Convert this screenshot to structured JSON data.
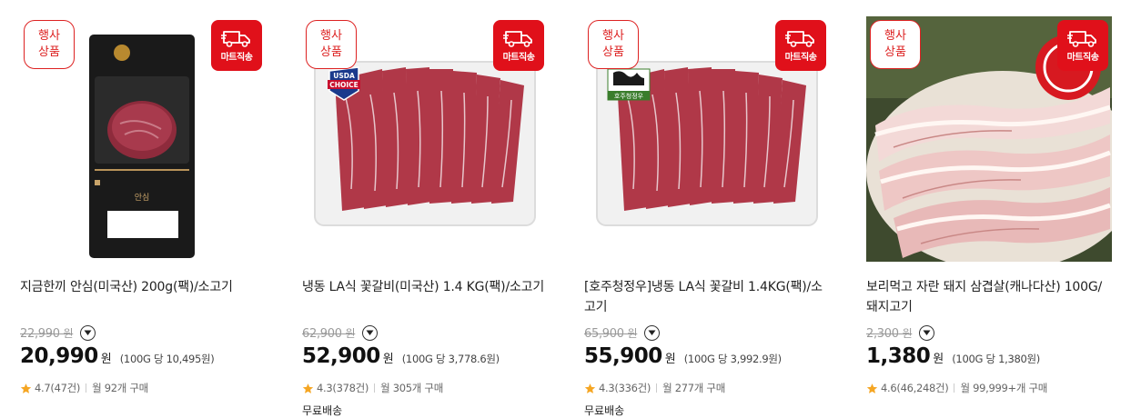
{
  "products": [
    {
      "event_badge": [
        "행사",
        "상품"
      ],
      "mart_badge": "마트직송",
      "title": "지금한끼 안심(미국산) 200g(팩)/소고기",
      "original_price": "22,990",
      "original_won": "원",
      "price": "20,990",
      "price_won": "원",
      "unit_price": "(100G 당 10,495원)",
      "rating": "4.7",
      "reviews": "(47건)",
      "monthly": "월 92개 구매",
      "shipping": ""
    },
    {
      "event_badge": [
        "행사",
        "상품"
      ],
      "mart_badge": "마트직송",
      "title": "냉동 LA식 꽃갈비(미국산) 1.4 KG(팩)/소고기",
      "original_price": "62,900",
      "original_won": "원",
      "price": "52,900",
      "price_won": "원",
      "unit_price": "(100G 당 3,778.6원)",
      "rating": "4.3",
      "reviews": "(378건)",
      "monthly": "월 305개 구매",
      "shipping": "무료배송"
    },
    {
      "event_badge": [
        "행사",
        "상품"
      ],
      "mart_badge": "마트직송",
      "title": "[호주청정우]냉동 LA식 꽃갈비 1.4KG(팩)/소고기",
      "original_price": "65,900",
      "original_won": "원",
      "price": "55,900",
      "price_won": "원",
      "unit_price": "(100G 당 3,992.9원)",
      "rating": "4.3",
      "reviews": "(336건)",
      "monthly": "월 277개 구매",
      "shipping": "무료배송"
    },
    {
      "event_badge": [
        "행사",
        "상품"
      ],
      "mart_badge": "마트직송",
      "title": "보리먹고 자란 돼지 삼겹살(캐나다산) 100G/돼지고기",
      "original_price": "2,300",
      "original_won": "원",
      "price": "1,380",
      "price_won": "원",
      "unit_price": "(100G 당 1,380원)",
      "rating": "4.6",
      "reviews": "(46,248건)",
      "monthly": "월 99,999+개 구매",
      "shipping": ""
    }
  ],
  "package_labels": {
    "usda_choice": [
      "USDA",
      "CHOICE"
    ],
    "aussie": "호주청정우",
    "tenderloin": "안심"
  },
  "colors": {
    "accent_red": "#e0101a",
    "badge_red": "#dd2222",
    "star": "#f5a623"
  }
}
